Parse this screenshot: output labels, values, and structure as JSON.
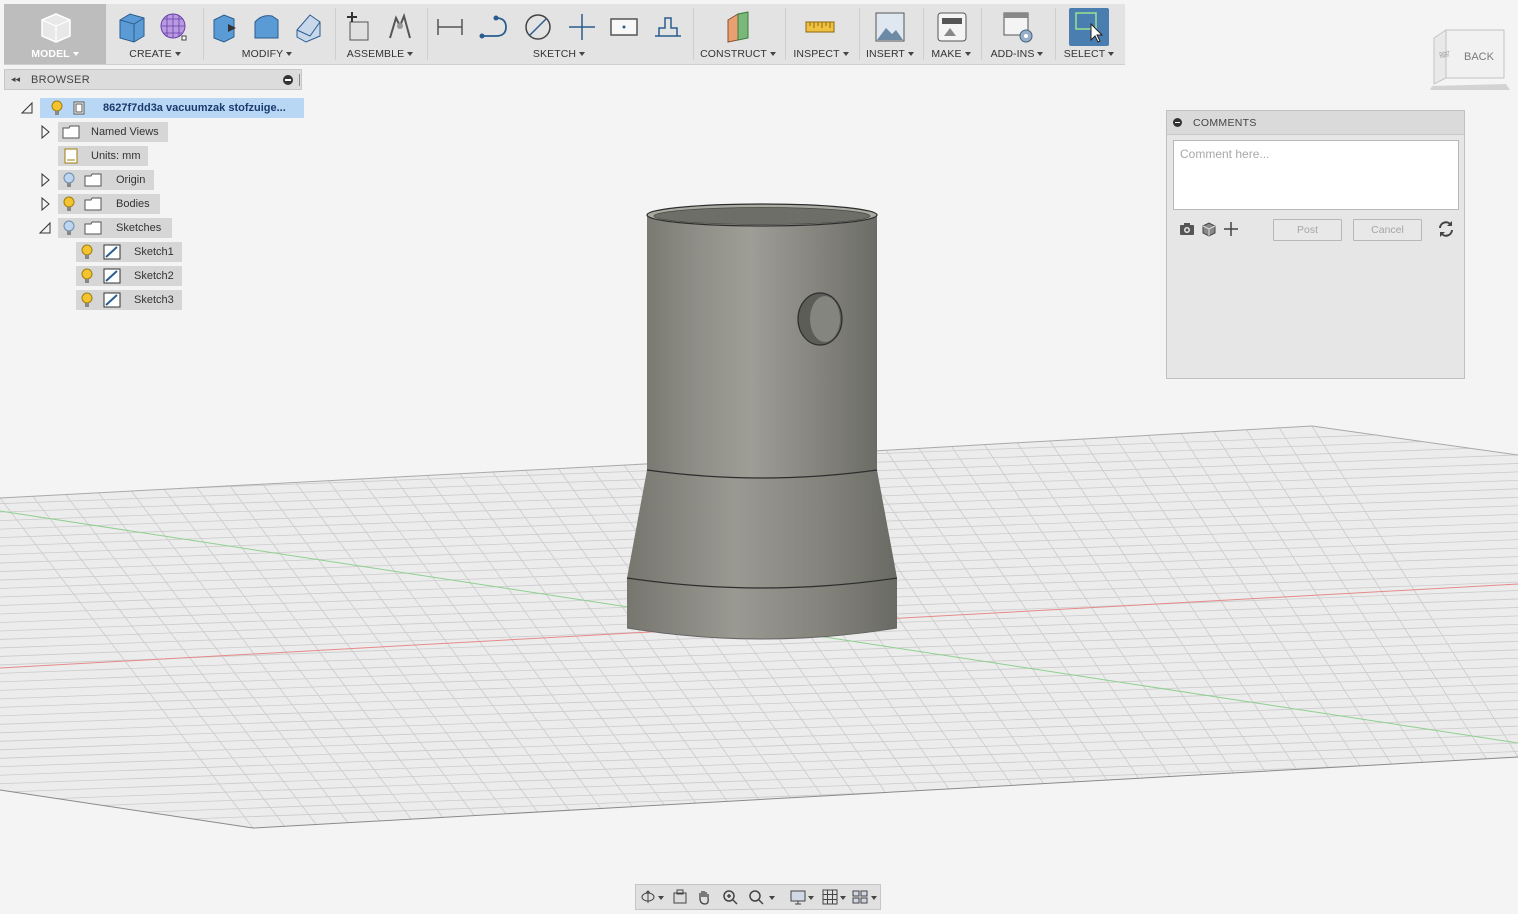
{
  "toolbar": {
    "groups": [
      {
        "label": "MODEL"
      },
      {
        "label": "CREATE"
      },
      {
        "label": "MODIFY"
      },
      {
        "label": "ASSEMBLE"
      },
      {
        "label": "SKETCH"
      },
      {
        "label": "CONSTRUCT"
      },
      {
        "label": "INSPECT"
      },
      {
        "label": "INSERT"
      },
      {
        "label": "MAKE"
      },
      {
        "label": "ADD-INS"
      },
      {
        "label": "SELECT"
      }
    ]
  },
  "browser": {
    "title": "BROWSER",
    "root": {
      "label": "8627f7dd3a vacuumzak stofzuige..."
    },
    "nodes": [
      {
        "label": "Named Views",
        "icon": "folder-icon"
      },
      {
        "label": "Units: mm",
        "icon": "document-icon"
      },
      {
        "label": "Origin",
        "icon": "folder-icon"
      },
      {
        "label": "Bodies",
        "icon": "folder-icon"
      },
      {
        "label": "Sketches",
        "icon": "folder-icon"
      },
      {
        "label": "Sketch1",
        "icon": "sketch-icon"
      },
      {
        "label": "Sketch2",
        "icon": "sketch-icon"
      },
      {
        "label": "Sketch3",
        "icon": "sketch-icon"
      }
    ]
  },
  "comments": {
    "title": "COMMENTS",
    "placeholder": "Comment here...",
    "post_label": "Post",
    "cancel_label": "Cancel"
  },
  "viewcube": {
    "left_face": "RIGHT",
    "front_face": "BACK"
  },
  "colors": {
    "selection": "#b8d7f4",
    "select_tool": "#4a7eb0",
    "x_axis": "#e25555",
    "y_axis": "#5ab85a",
    "grid": "#c8c8c8"
  }
}
